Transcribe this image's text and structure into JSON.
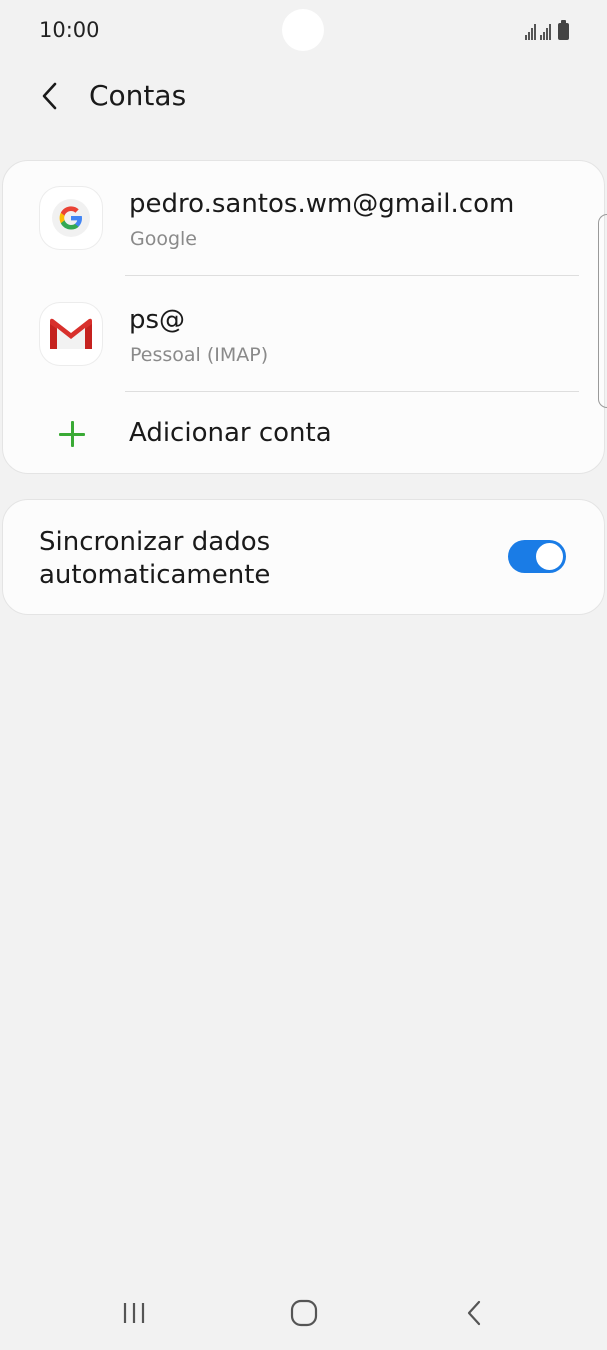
{
  "status_bar": {
    "time": "10:00",
    "icons": [
      "signal-icon",
      "signal-icon",
      "battery-icon"
    ]
  },
  "header": {
    "back_icon": "chevron-left-icon",
    "title": "Contas"
  },
  "accounts": [
    {
      "title": "pedro.santos.wm@gmail.com",
      "subtitle": "Google",
      "icon": "google-icon"
    },
    {
      "title": "ps@",
      "subtitle": "Pessoal (IMAP)",
      "icon": "gmail-icon"
    }
  ],
  "add_account": {
    "label": "Adicionar conta",
    "icon": "plus-icon"
  },
  "sync": {
    "label": "Sincronizar dados automaticamente",
    "enabled": true
  },
  "colors": {
    "background": "#f2f2f2",
    "card": "#fcfcfc",
    "accent": "#1a7ce6",
    "add_green": "#3aaa35",
    "secondary_text": "#8a8a8a"
  },
  "nav_bar": {
    "icons": [
      "recents-icon",
      "home-icon",
      "back-icon"
    ]
  }
}
